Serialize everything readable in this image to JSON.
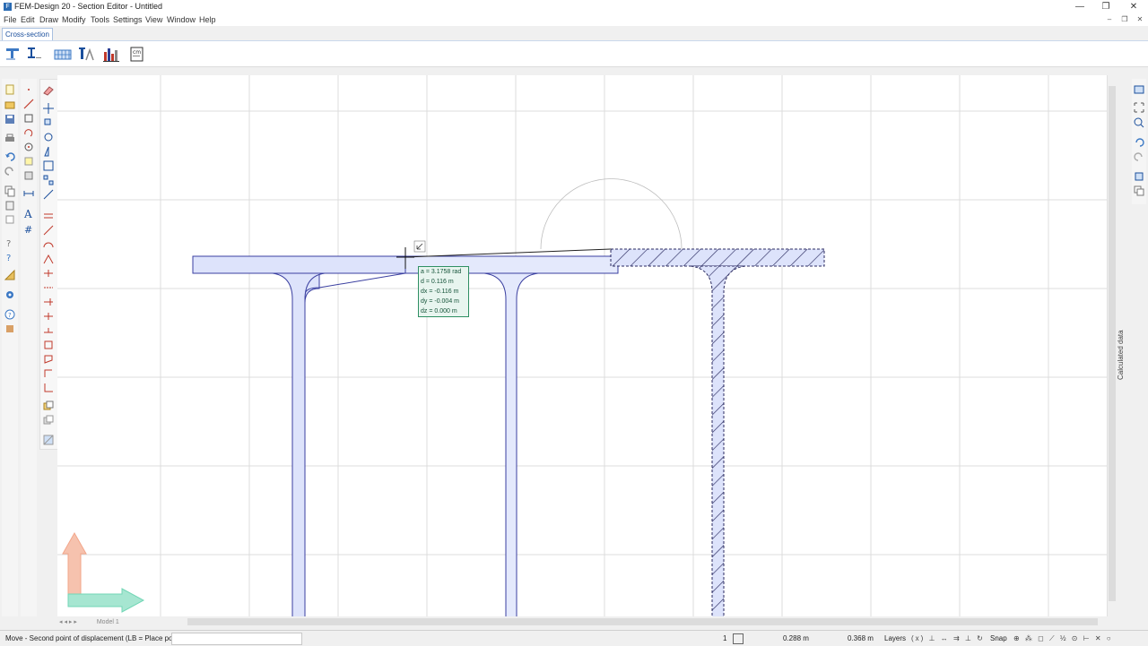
{
  "window": {
    "title": "FEM-Design 20 - Section Editor - Untitled",
    "controls": [
      "—",
      "❐",
      "✕"
    ]
  },
  "menu": [
    "File",
    "Edit",
    "Draw",
    "Modify",
    "Tools",
    "Settings",
    "View",
    "Window",
    "Help"
  ],
  "ribbon": {
    "tab": "Cross-section",
    "buttons": [
      "section-icon",
      "profile-icon",
      "grid-icon",
      "text-style-icon",
      "chart-icon",
      "units-icon"
    ]
  },
  "tooltip": {
    "rows": [
      "a  =  3.1758 rad",
      "d  =   0.116 m",
      "dx =  -0.116 m",
      "dy =  -0.004 m",
      "dz =   0.000 m"
    ]
  },
  "canvas_tabs": {
    "nav": "◂ ◂ ▸ ▸",
    "model": "Model 1"
  },
  "right_panel": {
    "label": "Calculated data"
  },
  "status": {
    "prompt": "Move - Second point of displacement (LB = Place point) :",
    "count": "1",
    "x": "0.288 m",
    "y": "0.368 m",
    "layers": "Layers",
    "snap": "Snap"
  },
  "colors": {
    "section_fill": "#dde3fb",
    "section_stroke": "#3a3fa0",
    "hatch": "#2a2a60",
    "tooltip_bg": "#e8f5ef",
    "tooltip_border": "#2f8f63",
    "axis_y": "#f3a68a",
    "axis_x": "#73d6b6"
  }
}
